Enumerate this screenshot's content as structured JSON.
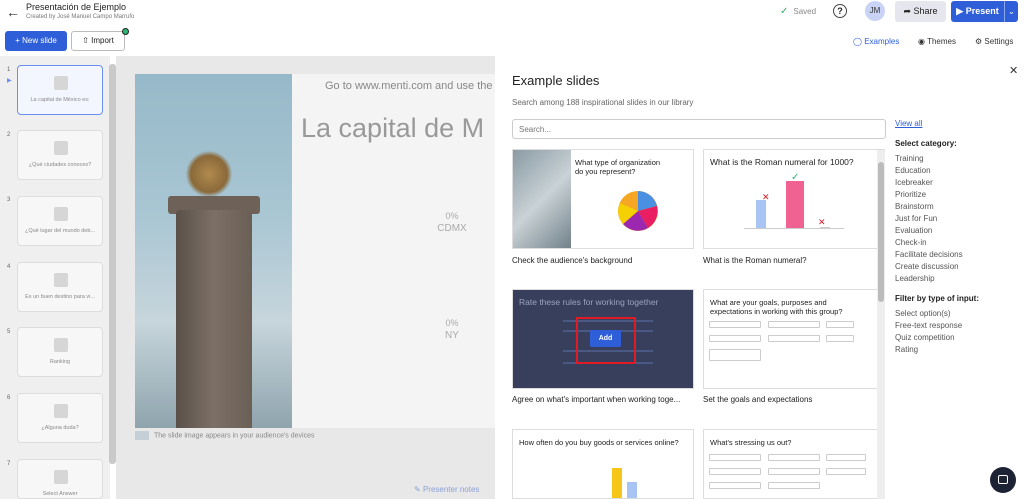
{
  "header": {
    "presentation_title": "Presentación de Ejemplo",
    "created_by": "Created by José Manuel Campo Marrufo",
    "saved_label": "Saved",
    "help": "?",
    "avatar_initials": "JM",
    "share_label": "Share",
    "present_label": "Present"
  },
  "toolbar": {
    "new_slide_label": "New slide",
    "import_label": "Import",
    "examples_label": "Examples",
    "themes_label": "Themes",
    "settings_label": "Settings"
  },
  "slides": [
    {
      "num": "1",
      "label": "La capital de México es:"
    },
    {
      "num": "2",
      "label": "¿Qué ciudades conoces?"
    },
    {
      "num": "3",
      "label": "¿Qué lugar del mundo deb..."
    },
    {
      "num": "4",
      "label": "Es un buen destino para vi..."
    },
    {
      "num": "5",
      "label": "Ranking"
    },
    {
      "num": "6",
      "label": "¿Alguna duda?"
    },
    {
      "num": "7",
      "label": "Select Answer"
    }
  ],
  "slide_preview": {
    "instruction": "Go to www.menti.com and use the",
    "question": "La capital de M",
    "options": [
      {
        "pct": "0%",
        "label": "CDMX"
      },
      {
        "pct": "0%",
        "label": "NY"
      }
    ],
    "image_note": "The slide image appears in your audience's devices",
    "presenter_notes": "Presenter notes"
  },
  "examples_panel": {
    "title": "Example slides",
    "description": "Search among 188 inspirational slides in our library",
    "search_placeholder": "Search...",
    "view_all": "View all",
    "category_heading": "Select category:",
    "categories": [
      "Training",
      "Education",
      "Icebreaker",
      "Prioritize",
      "Brainstorm",
      "Just for Fun",
      "Evaluation",
      "Check-in",
      "Facilitate decisions",
      "Create discussion",
      "Leadership"
    ],
    "input_type_heading": "Filter by type of input:",
    "input_types": [
      "Select option(s)",
      "Free-text response",
      "Quiz competition",
      "Rating"
    ],
    "cards": [
      {
        "question": "What type of organization do you represent?",
        "title": "Check the audience's background"
      },
      {
        "question": "What is the Roman numeral for 1000?",
        "title": "What is the Roman numeral?"
      },
      {
        "question": "Rate these rules for working together",
        "title": "Agree on what's important when working toge...",
        "add_label": "Add"
      },
      {
        "question": "What are your goals, purposes and expectations in working with this group?",
        "title": "Set the goals and expectations"
      },
      {
        "question": "How often do you buy goods or services online?",
        "title": ""
      },
      {
        "question": "What's stressing us out?",
        "title": ""
      }
    ]
  },
  "colors": {
    "primary": "#2e5fd8",
    "highlight": "#e01b24",
    "bar_blue": "#a8c4f4",
    "bar_pink": "#f06292"
  }
}
